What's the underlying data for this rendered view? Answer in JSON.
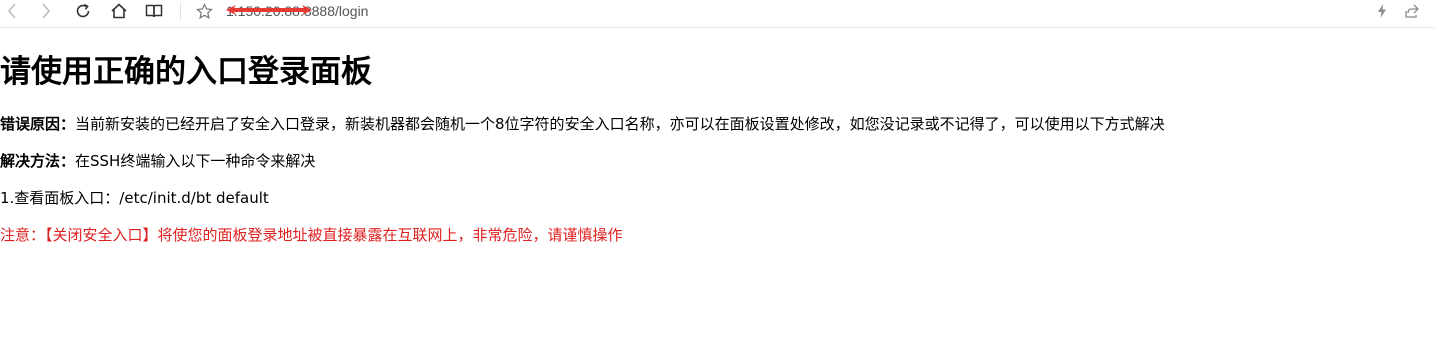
{
  "browser": {
    "url": "1.150.20.88:8888/login",
    "icons": {
      "back": "back-arrow-icon",
      "forward": "forward-arrow-icon",
      "reload": "reload-icon",
      "home": "home-icon",
      "reader": "reader-mode-icon",
      "bookmark": "star-icon",
      "lightning": "lightning-icon",
      "share": "share-icon"
    },
    "redaction_color": "#e53935"
  },
  "page": {
    "title": "请使用正确的入口登录面板",
    "error_label": "错误原因：",
    "error_text": "当前新安装的已经开启了安全入口登录，新装机器都会随机一个8位字符的安全入口名称，亦可以在面板设置处修改，如您没记录或不记得了，可以使用以下方式解决",
    "solution_label": "解决方法：",
    "solution_text": "在SSH终端输入以下一种命令来解决",
    "step1": "1.查看面板入口：/etc/init.d/bt default",
    "warning": "注意：【关闭安全入口】将使您的面板登录地址被直接暴露在互联网上，非常危险，请谨慎操作",
    "warning_color": "#e02020"
  }
}
